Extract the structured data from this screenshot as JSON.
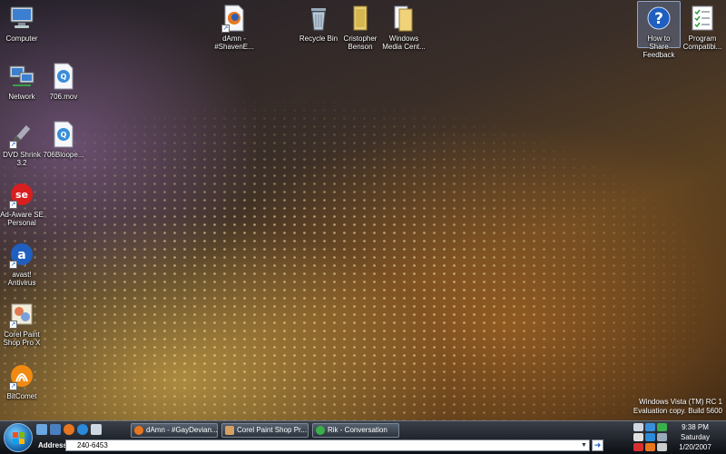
{
  "desktop": {
    "icons": [
      {
        "label": "Computer",
        "icon": "computer-icon"
      },
      {
        "label": "Network",
        "icon": "network-icon"
      },
      {
        "label": "DVD Shrink\n3.2",
        "icon": "dvd-shrink-icon"
      },
      {
        "label": "Ad-Aware SE\nPersonal",
        "icon": "ad-aware-icon"
      },
      {
        "label": "avast!\nAntivirus",
        "icon": "avast-icon"
      },
      {
        "label": "Corel Paint\nShop Pro X",
        "icon": "corel-paint-icon"
      },
      {
        "label": "BitComet",
        "icon": "bitcomet-icon"
      },
      {
        "label": "706.mov",
        "icon": "quicktime-file-icon"
      },
      {
        "label": "706Bloope...",
        "icon": "quicktime-file-icon"
      },
      {
        "label": "dAmn -\n#ShavenE...",
        "icon": "firefox-shortcut-icon"
      },
      {
        "label": "Recycle Bin",
        "icon": "recycle-bin-icon"
      },
      {
        "label": "Cristopher\nBenson",
        "icon": "user-folder-icon"
      },
      {
        "label": "Windows\nMedia Cent...",
        "icon": "folder-icon"
      },
      {
        "label": "How to Share\nFeedback",
        "icon": "help-icon"
      },
      {
        "label": "Program\nCompatibi...",
        "icon": "checklist-icon"
      }
    ],
    "watermark": {
      "line1": "Windows Vista (TM) RC 1",
      "line2": "Evaluation copy. Build 5600"
    }
  },
  "taskbar": {
    "quick_launch": [
      "show-desktop-icon",
      "switch-windows-icon",
      "firefox-icon",
      "internet-explorer-icon",
      "mail-icon"
    ],
    "tasks": [
      {
        "label": "dAmn - #GayDevian...",
        "icon": "firefox-icon"
      },
      {
        "label": "Corel Paint Shop Pr...",
        "icon": "corel-icon"
      },
      {
        "label": "Rik - Conversation",
        "icon": "messenger-icon"
      }
    ],
    "address": {
      "label": "Address",
      "value": "240-6453"
    },
    "clock": {
      "time": "9:38 PM",
      "day": "Saturday",
      "date": "1/20/2007"
    }
  },
  "colors": {
    "accent": "#1a6fb8",
    "taskbar": "#1b2028"
  }
}
